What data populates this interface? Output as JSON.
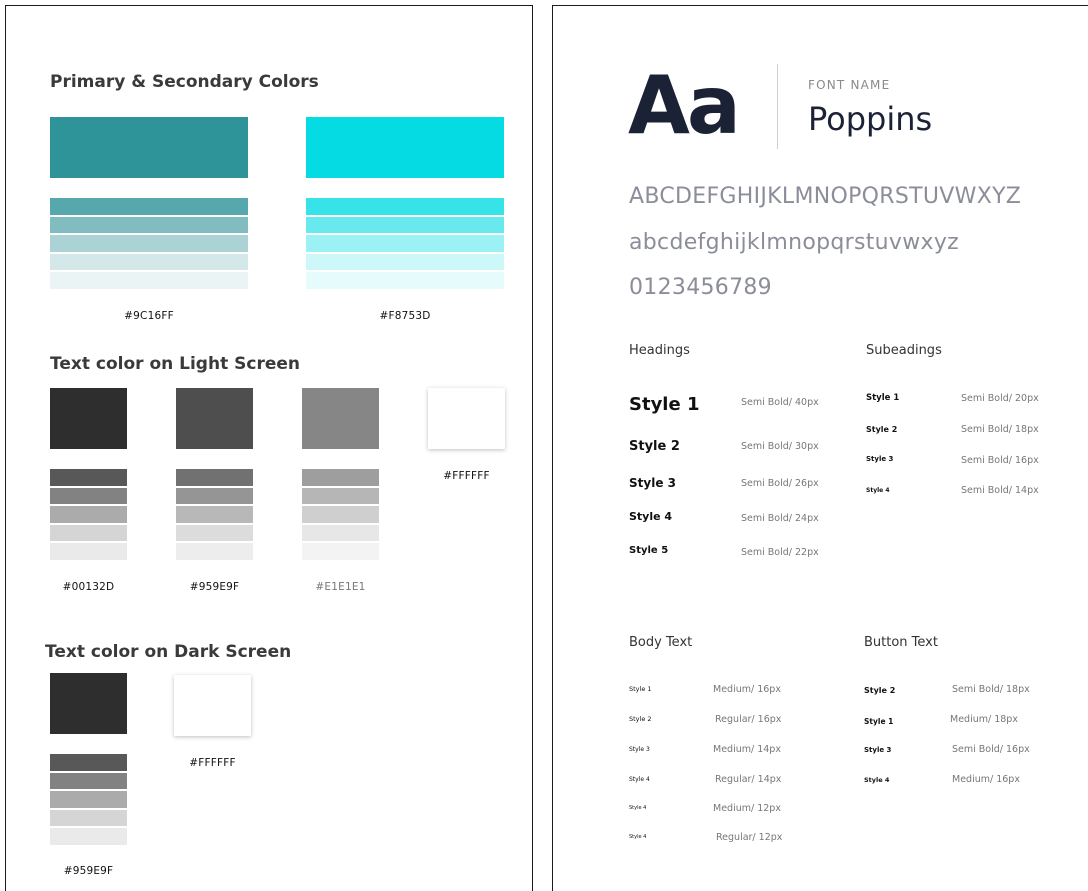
{
  "colors": {
    "primary_section_title": "Primary & Secondary Colors",
    "primary": {
      "hex_label": "#9C16FF",
      "main": "#2e9499",
      "tints": [
        "#57a8ac",
        "#81bdc0",
        "#abd2d4",
        "#d5e8e9",
        "#eaf4f4"
      ]
    },
    "secondary": {
      "hex_label": "#F8753D",
      "main": "#04dbe3",
      "tints": [
        "#36e3e9",
        "#68e9ee",
        "#9bf1f4",
        "#cdf8fa",
        "#e6fcfc"
      ]
    },
    "light_section_title": "Text color on Light Screen",
    "light": [
      {
        "hex_label": "#00132D",
        "main": "#2e2e2e",
        "tints": [
          "#585858",
          "#828282",
          "#ababab",
          "#d5d5d5",
          "#eaeaea"
        ]
      },
      {
        "hex_label": "#959E9F",
        "main": "#4e4e4e",
        "tints": [
          "#717171",
          "#959595",
          "#b8b8b8",
          "#dcdcdc",
          "#ededed"
        ]
      },
      {
        "hex_label": "#E1E1E1",
        "main": "#868686",
        "tints": [
          "#9e9e9e",
          "#b6b6b6",
          "#cfcfcf",
          "#e7e7e7",
          "#f3f3f3"
        ]
      },
      {
        "hex_label": "#FFFFFF",
        "main": "#ffffff",
        "tints": []
      }
    ],
    "dark_section_title": "Text color on Dark Screen",
    "dark": [
      {
        "hex_label": "#959E9F",
        "main": "#2e2e2e",
        "tints": [
          "#585858",
          "#828282",
          "#ababab",
          "#d5d5d5",
          "#eaeaea"
        ]
      },
      {
        "hex_label": "#FFFFFF",
        "main": "#ffffff",
        "tints": []
      }
    ]
  },
  "typography": {
    "sample_glyphs": "Aa",
    "font_label": "FONT NAME",
    "font_name": "Poppins",
    "uppercase": "ABCDEFGHIJKLMNOPQRSTUVWXYZ",
    "lowercase": "abcdefghijklmnopqrstuvwxyz",
    "digits": "0123456789",
    "headings": {
      "title": "Headings",
      "styles": [
        {
          "name": "Style 1",
          "meta": "Semi Bold/ 40px"
        },
        {
          "name": "Style 2",
          "meta": "Semi Bold/ 30px"
        },
        {
          "name": "Style 3",
          "meta": "Semi Bold/ 26px"
        },
        {
          "name": "Style 4",
          "meta": "Semi Bold/ 24px"
        },
        {
          "name": "Style 5",
          "meta": "Semi Bold/ 22px"
        }
      ]
    },
    "subheadings": {
      "title": "Subeadings",
      "styles": [
        {
          "name": "Style 1",
          "meta": "Semi Bold/ 20px"
        },
        {
          "name": "Style 2",
          "meta": "Semi Bold/ 18px"
        },
        {
          "name": "Style 3",
          "meta": "Semi Bold/ 16px"
        },
        {
          "name": "Style 4",
          "meta": "Semi Bold/ 14px"
        }
      ]
    },
    "body_text": {
      "title": "Body Text",
      "styles": [
        {
          "name": "Style 1",
          "meta": "Medium/ 16px"
        },
        {
          "name": "Style 2",
          "meta": "Regular/ 16px"
        },
        {
          "name": "Style 3",
          "meta": "Medium/ 14px"
        },
        {
          "name": "Style 4",
          "meta": "Regular/ 14px"
        },
        {
          "name": "Style 4",
          "meta": "Medium/ 12px"
        },
        {
          "name": "Style 4",
          "meta": "Regular/ 12px"
        }
      ]
    },
    "button_text": {
      "title": "Button Text",
      "styles": [
        {
          "name": "Style 2",
          "meta": "Semi Bold/ 18px"
        },
        {
          "name": "Style 1",
          "meta": "Medium/ 18px"
        },
        {
          "name": "Style 3",
          "meta": "Semi Bold/ 16px"
        },
        {
          "name": "Style 4",
          "meta": "Medium/ 16px"
        }
      ]
    }
  }
}
